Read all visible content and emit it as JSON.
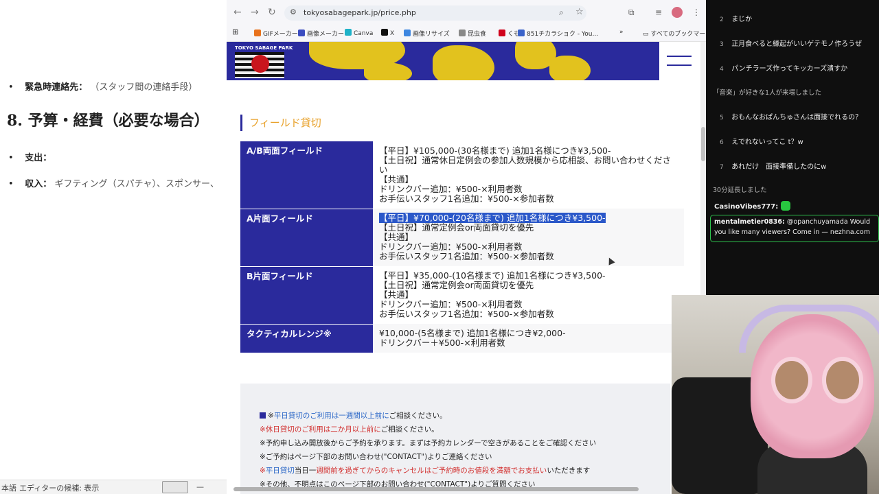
{
  "doc": {
    "emergency_label": "緊急時連絡先：",
    "emergency_value": "（スタッフ間の連絡手段）",
    "section_heading": "8. 予算・経費（必要な場合）",
    "expense_label": "支出：",
    "income_label": "収入：",
    "income_value": "ギフティング（スパチャ）、スポンサー、",
    "status_left": "本語",
    "status_editor": "エディターの候補: 表示"
  },
  "browser": {
    "url": "tokyosabagepark.jp/price.php",
    "bookmarks": [
      {
        "label": "GIFメーカー",
        "color": "#e8721c"
      },
      {
        "label": "画像メーカー",
        "color": "#3b4cc0"
      },
      {
        "label": "Canva",
        "color": "#1fb2c8"
      },
      {
        "label": "X",
        "color": "#111111"
      },
      {
        "label": "画像リサイズ",
        "color": "#3d86e0"
      },
      {
        "label": "昆虫食",
        "color": "#888888"
      },
      {
        "label": "くも",
        "color": "#d0021b"
      },
      {
        "label": "851チカラショク - You...",
        "color": "#3a62c9"
      }
    ],
    "all_bookmarks": "すべてのブックマーク",
    "logo_text": "TOKYO SABAGE PARK",
    "section_title": "フィールド貸切",
    "rows": [
      {
        "name": "A/B両面フィールド",
        "lines": [
          "【平日】¥105,000-(30名様まで) 追加1名様につき¥3,500-",
          "【土日祝】通常休日定例会の参加人数規模から応相談、お問い合わせくださ",
          "い",
          "【共通】",
          "ドリンクバー追加：¥500-×利用者数",
          "お手伝いスタッフ1名追加：¥500-×参加者数"
        ]
      },
      {
        "name": "A片面フィールド",
        "selected": "【平日】¥70,000-(20名様まで) 追加1名様につき¥3,500-",
        "lines": [
          "【土日祝】通常定例会or両面貸切を優先",
          "【共通】",
          "ドリンクバー追加：¥500-×利用者数",
          "お手伝いスタッフ1名追加：¥500-×参加者数"
        ]
      },
      {
        "name": "B片面フィールド",
        "lines": [
          "【平日】¥35,000-(10名様まで) 追加1名様につき¥3,500-",
          "【土日祝】通常定例会or両面貸切を優先",
          "【共通】",
          "ドリンクバー追加：¥500-×利用者数",
          "お手伝いスタッフ1名追加：¥500-×参加者数"
        ]
      },
      {
        "name": "タクティカルレンジ※",
        "lines": [
          "¥10,000-(5名様まで) 追加1名様につき¥2,000-",
          "ドリンクバー＋¥500-×利用者数"
        ]
      }
    ],
    "notes": {
      "n1_prefix": "※",
      "n1_blue": "平日貸切のご利用は一週間以上前に",
      "n1_rest": "ご相談ください。",
      "n2_red": "※休日貸切のご利用は二か月以上前に",
      "n2_rest": "ご相談ください。",
      "n3": "※予約申し込み開放後からご予約を承ります。まずは予約カレンダーで空きがあることをご確認ください",
      "n4": "※ご予約はページ下部のお問い合わせ(\"CONTACT\")よりご連絡ください",
      "n5_prefix": "※",
      "n5_blue": "平日貸切",
      "n5_mid": "当日一",
      "n5_red": "週間前を過ぎてからのキャンセルはご予約時のお値段を満額でお支払い",
      "n5_rest": "いただきます",
      "n6": "※その他、不明点はこのページ下部のお問い合わせ(\"CONTACT\")よりご質問ください"
    }
  },
  "chat": {
    "items": [
      {
        "num": "2",
        "text": "まじか"
      },
      {
        "num": "3",
        "text": "正月食べると縁起がいいゲテモノ作ろうぜ"
      },
      {
        "num": "4",
        "text": "パンチラーズ作ってキッカーズ潰すか"
      },
      {
        "num": "5",
        "text": "おもんなおぱんちゅさんは面接でれるの？"
      },
      {
        "num": "6",
        "text": "えでれないってこ t？w"
      },
      {
        "num": "7",
        "text": "あれだけ　面接準備したのにw"
      }
    ],
    "sys1": "「音楽」が好きな1人が来場しました",
    "sys2": "30分延長しました",
    "user1": "CasinoVibes777:",
    "user2": "mentalmetier0836:",
    "user2_msg": "@opanchuyamada Would you like many viewers? Come in — nezhna.com"
  }
}
